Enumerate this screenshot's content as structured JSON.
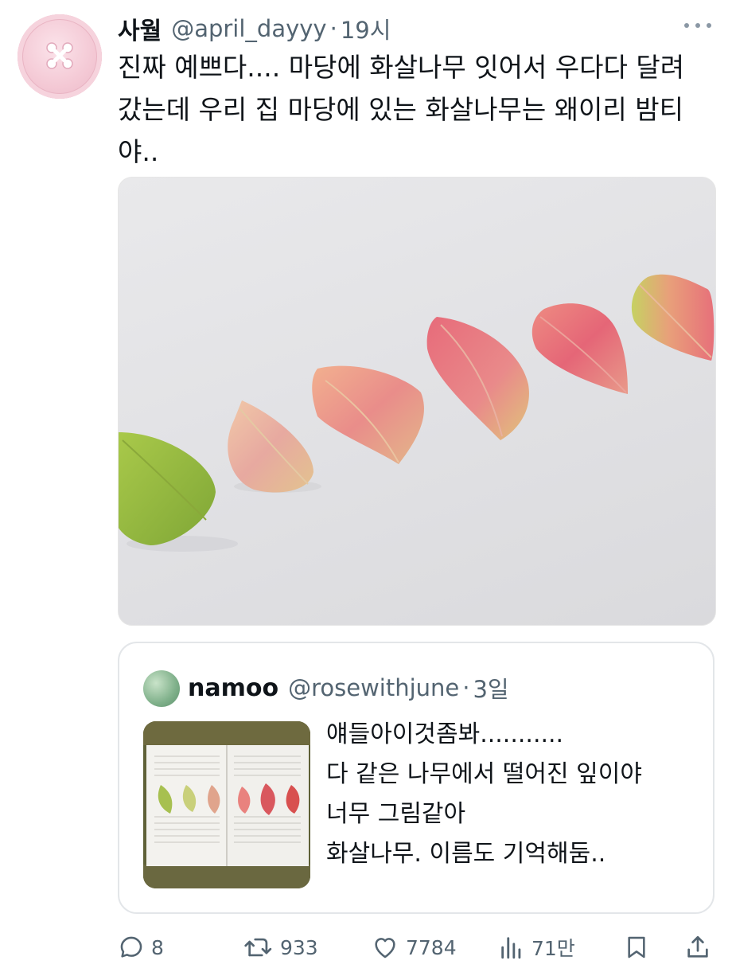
{
  "tweet": {
    "author_name": "사월",
    "handle": "@april_dayyy",
    "separator": "·",
    "time": "19시",
    "text_lines": [
      "진짜 예쁘다.... 마당에 화살나무 잇어서 우다다 달려",
      "갔는데 우리 집 마당에 있는 화살나무는 왜이리 밤티",
      "야.."
    ]
  },
  "quote": {
    "author_name": "namoo",
    "handle": "@rosewithjune",
    "separator": "·",
    "time": "3일",
    "text_lines": [
      "얘들아이것좀봐...........",
      "다 같은 나무에서 떨어진 잎이야",
      "너무 그림같아",
      "화살나무. 이름도 기억해둠.."
    ]
  },
  "actions": {
    "replies": "8",
    "retweets": "933",
    "likes": "7784",
    "views": "71만"
  },
  "icons": {
    "reply": "reply-icon",
    "retweet": "retweet-icon",
    "like": "heart-icon",
    "views": "views-icon",
    "bookmark": "bookmark-icon",
    "share": "share-icon",
    "more": "more-icon"
  },
  "colors": {
    "text": "#0f1419",
    "secondary": "#536471",
    "border": "#e3e6e9"
  }
}
